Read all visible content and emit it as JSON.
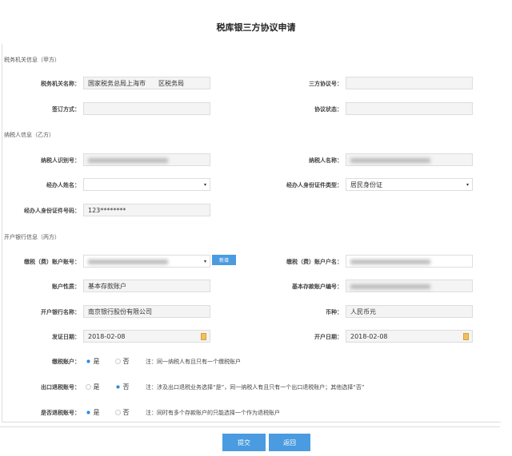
{
  "title": "税库银三方协议申请",
  "sections": {
    "tax_office": "税务机关信息（甲方）",
    "taxpayer": "纳税人信息（乙方）",
    "bank": "开户银行信息（丙方）"
  },
  "fields": {
    "tax_office_name": {
      "label": "税务机关名称：",
      "value": "国家税务总局上海市　　区税务局"
    },
    "agreement_no": {
      "label": "三方协议号：",
      "value": ""
    },
    "sign_method": {
      "label": "签订方式：",
      "value": ""
    },
    "agreement_status": {
      "label": "协议状态：",
      "value": ""
    },
    "taxpayer_id": {
      "label": "纳税人识别号：",
      "value": ""
    },
    "taxpayer_name": {
      "label": "纳税人名称：",
      "value": ""
    },
    "agent_name": {
      "label": "经办人姓名：",
      "value": ""
    },
    "agent_id_type": {
      "label": "经办人身份证件类型：",
      "value": "居民身份证"
    },
    "agent_id_no": {
      "label": "经办人身份证件号码：",
      "value": "123********"
    },
    "pay_account_no": {
      "label": "缴税（费）账户账号：",
      "value": ""
    },
    "pay_account_name": {
      "label": "缴税（费）账户户名：",
      "value": ""
    },
    "account_type": {
      "label": "账户性质：",
      "value": "基本存款账户"
    },
    "basic_account_no": {
      "label": "基本存款账户编号：",
      "value": ""
    },
    "bank_name": {
      "label": "开户银行名称：",
      "value": "南京银行股份有限公司"
    },
    "currency": {
      "label": "币种：",
      "value": "人民币元"
    },
    "issue_date": {
      "label": "发证日期：",
      "value": "2018-02-08"
    },
    "open_date": {
      "label": "开户日期：",
      "value": "2018-02-08"
    }
  },
  "add_button": "新增",
  "radios": {
    "yes": "是",
    "no": "否",
    "tax_account": {
      "label": "缴税账户：",
      "note": "注：同一纳税人有且只有一个缴税账户",
      "selected": "yes"
    },
    "export_refund": {
      "label": "出口退税账号：",
      "note": "注：涉及出口退税业务选择“是”，同一纳税人有且只有一个出口退税账户；其他选择“否”",
      "selected": "no"
    },
    "refund_account": {
      "label": "是否退税账号：",
      "note": "注：同时有多个存款账户的只能选择一个作为退税账户",
      "selected": "yes"
    }
  },
  "buttons": {
    "submit": "提交",
    "back": "返回"
  }
}
